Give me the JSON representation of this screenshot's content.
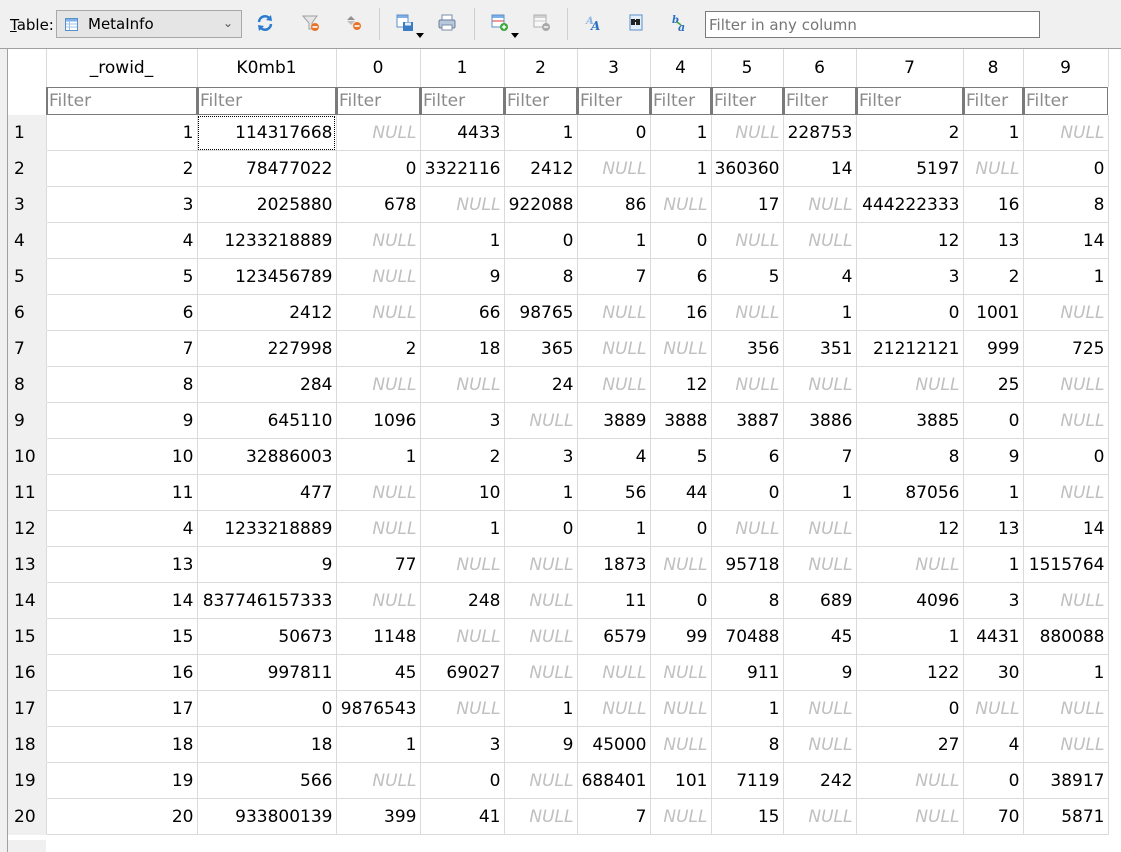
{
  "toolbar": {
    "table_label": "Table:",
    "table_label_accesskey": "T",
    "table_label_rest": "able:",
    "selected_table": "MetaInfo",
    "buttons": [
      {
        "name": "refresh-icon"
      },
      {
        "name": "clear-filters-icon"
      },
      {
        "name": "clear-sorting-icon"
      },
      {
        "name": "save-table-icon"
      },
      {
        "name": "print-icon"
      },
      {
        "name": "insert-record-icon"
      },
      {
        "name": "delete-record-icon"
      },
      {
        "name": "find-replace-icon"
      },
      {
        "name": "find-icon"
      },
      {
        "name": "replace-icon"
      }
    ],
    "global_filter_placeholder": "Filter in any column",
    "global_filter_value": ""
  },
  "grid": {
    "columns": [
      "_rowid_",
      "K0mb1",
      "0",
      "1",
      "2",
      "3",
      "4",
      "5",
      "6",
      "7",
      "8",
      "9"
    ],
    "filter_placeholder": "Filter",
    "null_text": "NULL",
    "selected_cell": {
      "row": 1,
      "column": "K0mb1"
    },
    "rows": [
      {
        "num": "1",
        "cells": [
          "1",
          "114317668",
          null,
          "4433",
          "1",
          "0",
          "1",
          null,
          "228753",
          "2",
          "1",
          null
        ]
      },
      {
        "num": "2",
        "cells": [
          "2",
          "78477022",
          "0",
          "3322116",
          "2412",
          null,
          "1",
          "360360",
          "14",
          "5197",
          null,
          "0"
        ]
      },
      {
        "num": "3",
        "cells": [
          "3",
          "2025880",
          "678",
          null,
          "922088",
          "86",
          null,
          "17",
          null,
          "444222333",
          "16",
          "8"
        ]
      },
      {
        "num": "4",
        "cells": [
          "4",
          "1233218889",
          null,
          "1",
          "0",
          "1",
          "0",
          null,
          null,
          "12",
          "13",
          "14"
        ]
      },
      {
        "num": "5",
        "cells": [
          "5",
          "123456789",
          null,
          "9",
          "8",
          "7",
          "6",
          "5",
          "4",
          "3",
          "2",
          "1"
        ]
      },
      {
        "num": "6",
        "cells": [
          "6",
          "2412",
          null,
          "66",
          "98765",
          null,
          "16",
          null,
          "1",
          "0",
          "1001",
          null
        ]
      },
      {
        "num": "7",
        "cells": [
          "7",
          "227998",
          "2",
          "18",
          "365",
          null,
          null,
          "356",
          "351",
          "21212121",
          "999",
          "725"
        ]
      },
      {
        "num": "8",
        "cells": [
          "8",
          "284",
          null,
          null,
          "24",
          null,
          "12",
          null,
          null,
          null,
          "25",
          null
        ]
      },
      {
        "num": "9",
        "cells": [
          "9",
          "645110",
          "1096",
          "3",
          null,
          "3889",
          "3888",
          "3887",
          "3886",
          "3885",
          "0",
          null
        ]
      },
      {
        "num": "10",
        "cells": [
          "10",
          "32886003",
          "1",
          "2",
          "3",
          "4",
          "5",
          "6",
          "7",
          "8",
          "9",
          "0"
        ]
      },
      {
        "num": "11",
        "cells": [
          "11",
          "477",
          null,
          "10",
          "1",
          "56",
          "44",
          "0",
          "1",
          "87056",
          "1",
          null
        ]
      },
      {
        "num": "12",
        "cells": [
          "4",
          "1233218889",
          null,
          "1",
          "0",
          "1",
          "0",
          null,
          null,
          "12",
          "13",
          "14"
        ]
      },
      {
        "num": "13",
        "cells": [
          "13",
          "9",
          "77",
          null,
          null,
          "1873",
          null,
          "95718",
          null,
          null,
          "1",
          "1515764"
        ]
      },
      {
        "num": "14",
        "cells": [
          "14",
          "837746157333",
          null,
          "248",
          null,
          "11",
          "0",
          "8",
          "689",
          "4096",
          "3",
          null
        ]
      },
      {
        "num": "15",
        "cells": [
          "15",
          "50673",
          "1148",
          null,
          null,
          "6579",
          "99",
          "70488",
          "45",
          "1",
          "4431",
          "880088"
        ]
      },
      {
        "num": "16",
        "cells": [
          "16",
          "997811",
          "45",
          "69027",
          null,
          null,
          null,
          "911",
          "9",
          "122",
          "30",
          "1"
        ]
      },
      {
        "num": "17",
        "cells": [
          "17",
          "0",
          "9876543",
          null,
          "1",
          null,
          null,
          "1",
          null,
          "0",
          null,
          null
        ]
      },
      {
        "num": "18",
        "cells": [
          "18",
          "18",
          "1",
          "3",
          "9",
          "45000",
          null,
          "8",
          null,
          "27",
          "4",
          null
        ]
      },
      {
        "num": "19",
        "cells": [
          "19",
          "566",
          null,
          "0",
          null,
          "688401",
          "101",
          "7119",
          "242",
          null,
          "0",
          "38917"
        ]
      },
      {
        "num": "20",
        "cells": [
          "20",
          "933800139",
          "399",
          "41",
          null,
          "7",
          null,
          "15",
          null,
          null,
          "70",
          "5871"
        ]
      }
    ]
  },
  "colors": {
    "null_text": "#c0c0c0",
    "grid_line": "#dadada",
    "toolbar_bg": "#f0f0f0",
    "icon_blue": "#2b7bd0",
    "icon_orange": "#e8742a"
  }
}
